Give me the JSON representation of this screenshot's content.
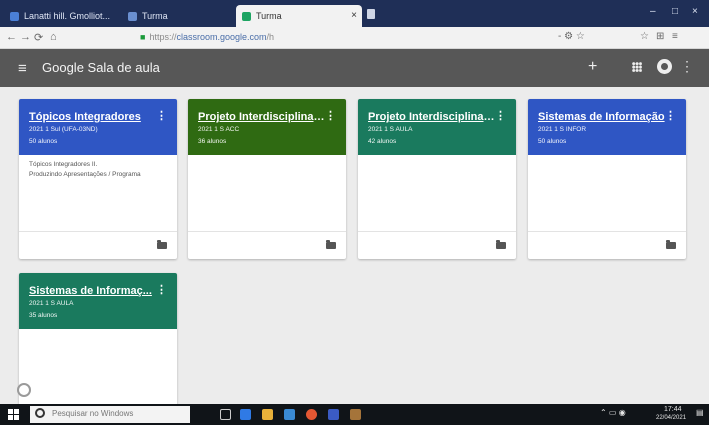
{
  "browser": {
    "tabs": [
      {
        "label": "Lanatti hill. Gmolliot...",
        "fav_color": "#4a7fd6"
      },
      {
        "label": "Turma",
        "fav_color": "#6a8fd0"
      },
      {
        "label": "Turma",
        "fav_color": "#1da462"
      }
    ],
    "url_prefix": "https://",
    "url_domain": "classroom.google.com",
    "url_suffix": "/h",
    "toolbar_text": "- ⚙ ☆"
  },
  "app": {
    "title": "Google Sala de aula"
  },
  "classes": [
    {
      "title": "Tópicos Integradores",
      "subtitle": "2021 1 Sul (UFA-03ND)",
      "count": "50 alunos",
      "color": "#2f56c4",
      "lines": [
        "Tópicos Integradores II.",
        "Produzindo Apresentações / Programa"
      ]
    },
    {
      "title": "Projeto Interdisciplinar...",
      "subtitle": "2021 1 S ACC",
      "count": "36 alunos",
      "color": "#2f6a12",
      "lines": []
    },
    {
      "title": "Projeto Interdisciplinar...",
      "subtitle": "2021 1 S AULA",
      "count": "42 alunos",
      "color": "#1a7a5e",
      "lines": []
    },
    {
      "title": "Sistemas de Informação",
      "subtitle": "2021 1 S INFOR",
      "count": "50 alunos",
      "color": "#2f56c4",
      "lines": []
    },
    {
      "title": "Sistemas de Informaç...",
      "subtitle": "2021 1 S AULA",
      "count": "35 alunos",
      "color": "#1a7a5e",
      "lines": []
    }
  ],
  "taskbar": {
    "search_placeholder": "Pesquisar no Windows",
    "time": "17:44",
    "date": "22/04/2021"
  }
}
